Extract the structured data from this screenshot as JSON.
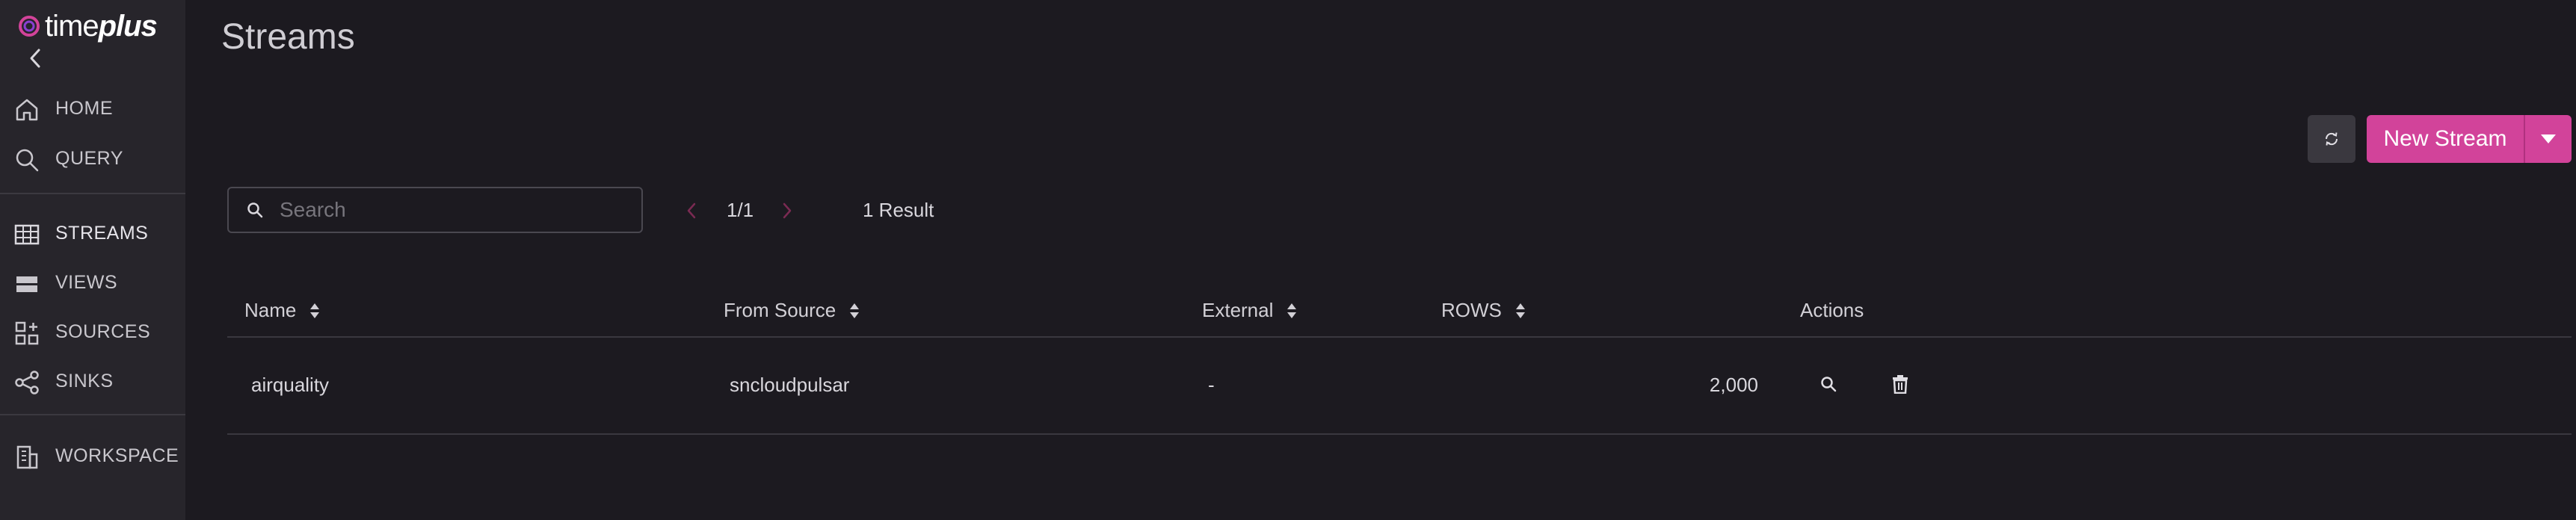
{
  "brand": {
    "logo_prefix": "time",
    "logo_suffix": "plus"
  },
  "sidebar": {
    "items": [
      {
        "label": "HOME",
        "icon": "home-icon"
      },
      {
        "label": "QUERY",
        "icon": "search-icon"
      },
      {
        "label": "STREAMS",
        "icon": "table-icon"
      },
      {
        "label": "VIEWS",
        "icon": "views-icon"
      },
      {
        "label": "SOURCES",
        "icon": "sources-icon"
      },
      {
        "label": "SINKS",
        "icon": "share-icon"
      },
      {
        "label": "WORKSPACE",
        "icon": "building-icon"
      }
    ]
  },
  "page": {
    "title": "Streams"
  },
  "toolbar": {
    "new_stream_label": "New Stream"
  },
  "search": {
    "placeholder": "Search",
    "value": ""
  },
  "pagination": {
    "page_text": "1/1",
    "results_text": "1 Result"
  },
  "table": {
    "headers": [
      "Name",
      "From Source",
      "External",
      "ROWS",
      "Actions"
    ],
    "rows": [
      {
        "name": "airquality",
        "from_source": "sncloudpulsar",
        "external": "-",
        "rows": "2,000"
      }
    ]
  },
  "colors": {
    "accent": "#d2439a",
    "sidebar_bg": "#27252b",
    "page_bg": "#1c1a20",
    "pager_arrow": "#7a2a52"
  }
}
